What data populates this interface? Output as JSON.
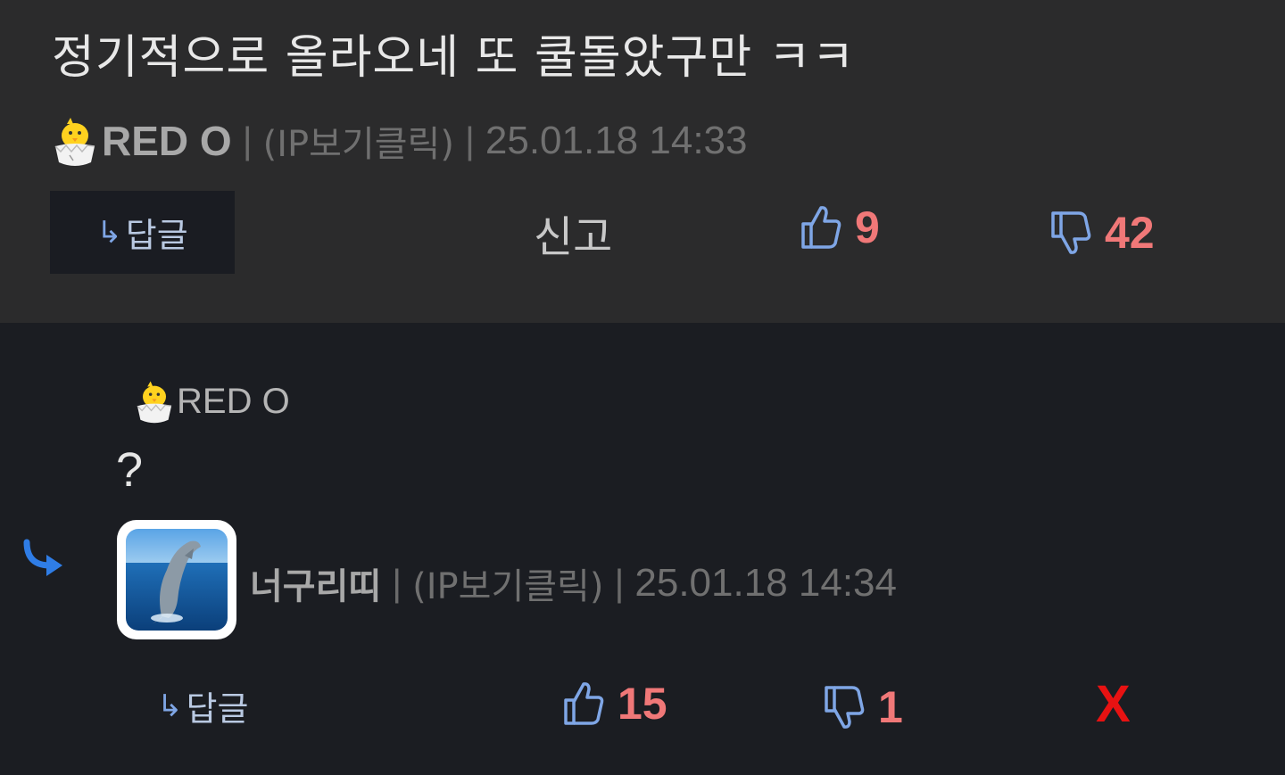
{
  "top_comment": {
    "text": "정기적으로 올라오네 또 쿨돌았구만 ㅋㅋ",
    "author_icon": "hatching-chick-icon",
    "author": "RED O",
    "separator": "|",
    "ip_label": "(IP보기클릭)",
    "datetime": "25.01.18 14:33",
    "reply_arrow": "↳",
    "reply_label": "답글",
    "report_label": "신고",
    "upvotes": "9",
    "downvotes": "42"
  },
  "reply": {
    "quoted_icon": "hatching-chick-icon",
    "quoted_author": "RED O",
    "text": "?",
    "author": "너구리띠",
    "avatar_icon": "dolphin-avatar",
    "separator": "|",
    "ip_label": "(IP보기클릭)",
    "datetime": "25.01.18 14:34",
    "reply_arrow": "↳",
    "reply_label": "답글",
    "upvotes": "15",
    "downvotes": "1",
    "delete_label": "X"
  },
  "colors": {
    "top_bg": "#2b2b2c",
    "page_bg": "#1b1d22",
    "vote_count": "#f07878",
    "thumb_icon": "#7fa6e6",
    "delete": "#e81212"
  }
}
